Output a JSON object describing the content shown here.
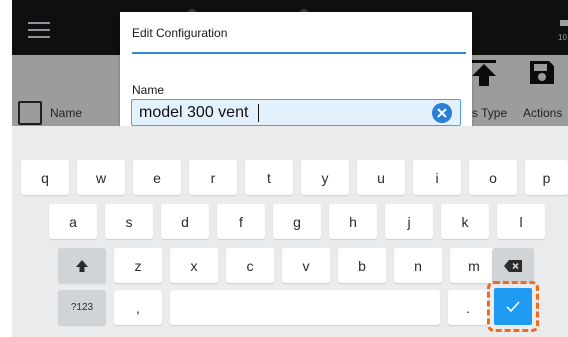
{
  "header": {
    "columns": {
      "name": "Name",
      "type": "s Type",
      "actions": "Actions"
    },
    "corner_text": "10"
  },
  "dialog": {
    "title": "Edit Configuration",
    "field_label": "Name",
    "field_value": "model 300 vent"
  },
  "keyboard": {
    "row1": [
      "q",
      "w",
      "e",
      "r",
      "t",
      "y",
      "u",
      "i",
      "o",
      "p"
    ],
    "row2": [
      "a",
      "s",
      "d",
      "f",
      "g",
      "h",
      "j",
      "k",
      "l"
    ],
    "row3": [
      "z",
      "x",
      "c",
      "v",
      "b",
      "n",
      "m"
    ],
    "symbols_key": "?123",
    "comma_key": ",",
    "period_key": "."
  },
  "colors": {
    "accent": "#2f88d8",
    "done_key": "#1e9bf0",
    "highlight": "#f36a1c",
    "appbar": "#0d0f10"
  },
  "icons": {
    "menu": "hamburger-icon",
    "upload": "upload-icon",
    "save": "save-icon",
    "clear": "clear-icon",
    "shift": "shift-icon",
    "backspace": "backspace-icon",
    "done": "checkmark-icon"
  }
}
